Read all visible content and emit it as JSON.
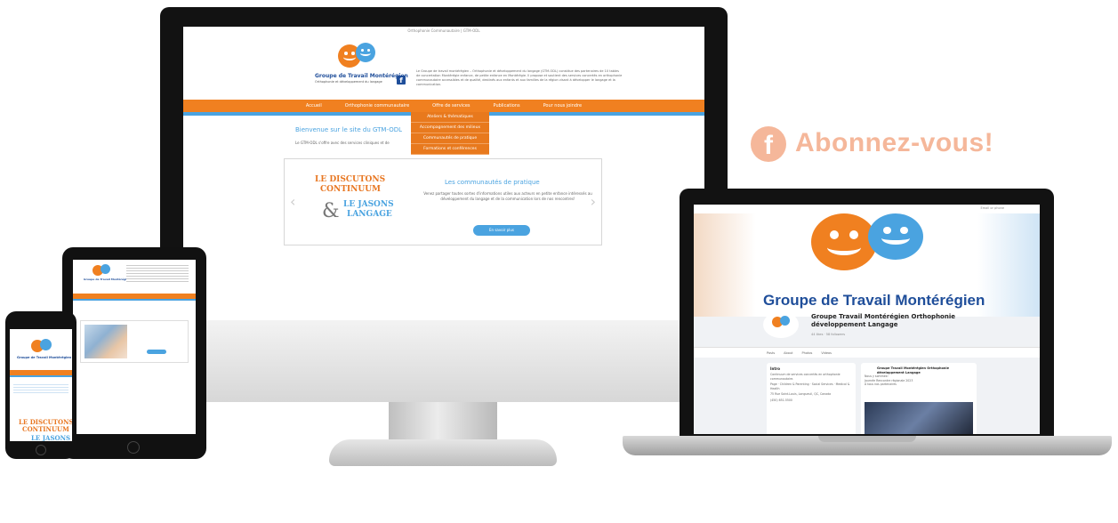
{
  "colors": {
    "orange": "#f08020",
    "blue": "#4aa3e0",
    "navy": "#1f4e9a",
    "subscribe": "#f5b79a"
  },
  "subscribe": {
    "icon": "facebook-icon",
    "label": "Abonnez-vous!"
  },
  "desktop": {
    "topbar": "Orthophonie Communautaire | GTM-ODL",
    "logo_title": "Groupe de Travail Montérégien",
    "logo_sub": "Orthophonie et développement du langage",
    "intro": "Le Groupe de travail montérégien – Orthophonie et développement du langage (GTM-ODL) constitue des partenaires de 10 tables de concertation Montérégie enfance, de petite enfance en Montérégie. Il propose et soutient des services concertés en orthophonie communautaire accessibles et de qualité, destinés aux enfants et aux familles de la région visant à développer le langage et la communication.",
    "nav": [
      "Accueil",
      "Orthophonie communautaire",
      "Offre de services",
      "Publications",
      "Pour nous joindre"
    ],
    "dropdown": [
      "Ateliers & thématiques",
      "Accompagnement des milieux",
      "Communautés de pratique",
      "Formations et conférences"
    ],
    "welcome": "Bienvenue sur le site du GTM-ODL",
    "lead": "Le GTM-ODL s'offre avec des services cliniques et de",
    "slide": {
      "brand1": "LE DISCUTONS",
      "brand2": "CONTINUUM",
      "amp": "&",
      "brand3": "LE JASONS",
      "brand4": "LANGAGE",
      "title": "Les communautés de pratique",
      "text": "Venez partager toutes sortes d'informations utiles aux acteurs en petite enfance intéressés au développement du langage et de la communication lors de nos rencontres!",
      "button": "En savoir plus",
      "prev": "‹",
      "next": "›"
    }
  },
  "laptop": {
    "cover_title": "Groupe de Travail Montérégien",
    "page_name": "Groupe Travail Montérégien Orthophonie développement Langage",
    "page_meta": "44 likes · 58 followers",
    "topbar_search": "Email or phone",
    "tabs": [
      "Posts",
      "About",
      "Photos",
      "Videos"
    ],
    "intro_title": "Intro",
    "intro_rows": [
      "Continuum de services concertés en orthophonie communautaire.",
      "Page · Children & Parenting · Social Services · Medical & Health",
      "75 Rue Saint-Louis, Longueuil, QC, Canada",
      "(450) 651-5500"
    ],
    "post_title": "Groupe Travail Montérégien Orthophonie développement Langage",
    "post_text": [
      "Nous y sommes!",
      "Journée Rencontre régionale 2023",
      "À tous nos partenaires"
    ]
  },
  "tablet": {
    "logo_title": "Groupe de Travail Montérégien"
  },
  "phone": {
    "logo_title": "Groupe de Travail Montérégien",
    "brand1": "LE DISCUTONS",
    "brand2": "CONTINUUM",
    "brand3": "LE JASONS"
  }
}
